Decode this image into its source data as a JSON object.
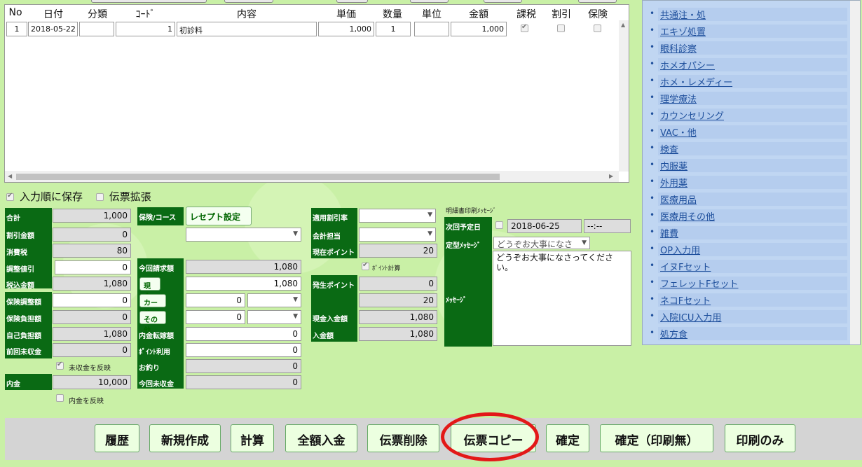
{
  "grid": {
    "headers": [
      "No",
      "日付",
      "分類",
      "ｺｰﾄﾞ",
      "内容",
      "単価",
      "数量",
      "単位",
      "金額",
      "課税",
      "割引",
      "保険"
    ],
    "rows": [
      {
        "no": "1",
        "date": "2018-05-22",
        "category": "",
        "code": "1",
        "content": "初診料",
        "unit_price": "1,000",
        "qty": "1",
        "unit": "",
        "amount": "1,000",
        "taxed": true,
        "discount": false,
        "insurance": false
      }
    ]
  },
  "options": {
    "save_order": "入力順に保存",
    "expand": "伝票拡張",
    "save_order_checked": true,
    "expand_checked": false
  },
  "left": {
    "labels": [
      "合計",
      "割引金額",
      "消費税",
      "調整値引",
      "税込金額",
      "保険調整額",
      "保険負担額",
      "自己負担額",
      "前回未収金"
    ],
    "values": [
      "1,000",
      "0",
      "80",
      "0",
      "1,080",
      "0",
      "0",
      "1,080",
      "0"
    ],
    "reflect_unpaid": "未収金を反映",
    "deposit_label": "内金",
    "deposit_value": "10,000",
    "reflect_deposit": "内金を反映"
  },
  "mid": {
    "insurance_label": "保険/コース",
    "receipt_button": "レセプト設定",
    "billing_label": "今回請求額",
    "billing_value": "1,080",
    "cash_button": "現金",
    "cash_value": "1,080",
    "card_button": "カード",
    "card_value": "0",
    "other_button": "その他",
    "other_value": "0",
    "transfer_label": "内金転嫁額",
    "transfer_value": "0",
    "points_label": "ﾎﾟｲﾝﾄ利用",
    "points_value": "0",
    "change_label": "お釣り",
    "change_value": "0",
    "unpaid_label": "今回未収金",
    "unpaid_value": "0"
  },
  "right": {
    "discount_rate_label": "適用割引率",
    "accounting_label": "会計担当",
    "current_points_label": "現在ポイント",
    "current_points_value": "20",
    "point_calc": "ﾎﾟｲﾝﾄ計算",
    "earned_points_label": "発生ポイント",
    "earned_points_value": "0",
    "points_total": "20",
    "cash_received_label": "現金入金額",
    "cash_received_value": "1,080",
    "received_label": "入金額",
    "received_value": "1,080"
  },
  "message": {
    "header": "明細書印刷ﾒｯｾｰｼﾞ",
    "next_label": "次回予定日",
    "next_date": "2018-06-25",
    "next_time": "--:--",
    "fixed_label": "定型ﾒｯｾｰｼﾞ",
    "fixed_value": "どうぞお大事になさ",
    "message_label": "ﾒｯｾｰｼﾞ",
    "message_text": "どうぞお大事になさってください。"
  },
  "buttons": [
    "履歴",
    "新規作成",
    "計算",
    "全額入金",
    "伝票削除",
    "伝票コピー",
    "確定",
    "確定（印刷無）",
    "印刷のみ"
  ],
  "sidebar": [
    "共通注・処",
    "エキゾ処置",
    "眼科診察",
    "ホメオパシー",
    "ホメ・レメディー",
    "理学療法",
    "カウンセリング",
    "VAC・他",
    "検査",
    "内服薬",
    "外用薬",
    "医療用品",
    "医療用その他",
    "雑費",
    "OP入力用",
    "イヌFセット",
    "フェレットFセット",
    "ネコFセット",
    "入院ICU入力用",
    "処方食"
  ]
}
